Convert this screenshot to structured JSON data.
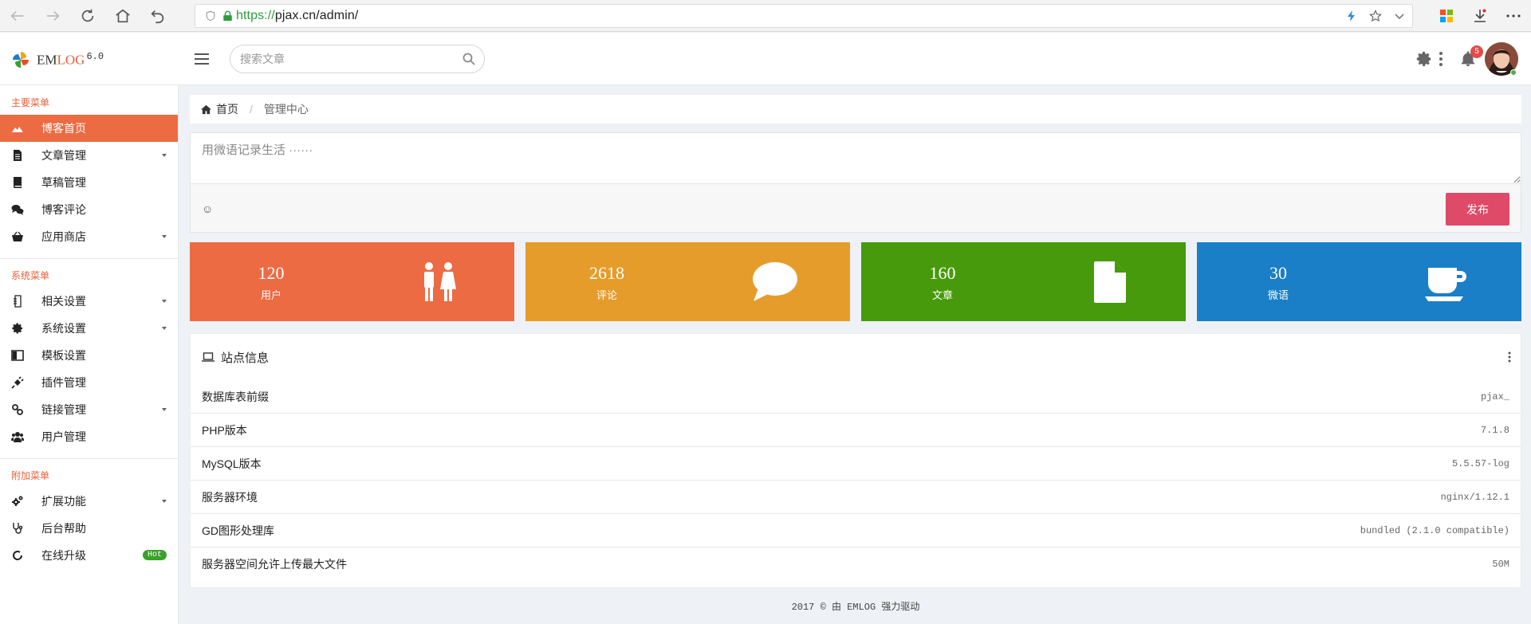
{
  "browser": {
    "url_scheme": "https://",
    "url_rest": "pjax.cn/admin/"
  },
  "header": {
    "brand_em": "EM",
    "brand_log": "LOG",
    "brand_version": "6.0",
    "search_placeholder": "搜索文章",
    "notification_count": "5"
  },
  "sidebar": {
    "section_main": "主要菜单",
    "section_system": "系统菜单",
    "section_extra": "附加菜单",
    "main_items": [
      {
        "label": "博客首页",
        "icon": "dashboard-icon",
        "active": true
      },
      {
        "label": "文章管理",
        "icon": "file-icon",
        "caret": true
      },
      {
        "label": "草稿管理",
        "icon": "book-icon"
      },
      {
        "label": "博客评论",
        "icon": "comments-icon"
      },
      {
        "label": "应用商店",
        "icon": "basket-icon",
        "caret": true
      }
    ],
    "system_items": [
      {
        "label": "相关设置",
        "icon": "settings-file-icon",
        "caret": true
      },
      {
        "label": "系统设置",
        "icon": "gear-icon",
        "caret": true
      },
      {
        "label": "模板设置",
        "icon": "template-icon"
      },
      {
        "label": "插件管理",
        "icon": "plug-icon"
      },
      {
        "label": "链接管理",
        "icon": "link-icon",
        "caret": true
      },
      {
        "label": "用户管理",
        "icon": "users-icon"
      }
    ],
    "extra_items": [
      {
        "label": "扩展功能",
        "icon": "cogs-icon",
        "caret": true
      },
      {
        "label": "后台帮助",
        "icon": "stethoscope-icon"
      },
      {
        "label": "在线升级",
        "icon": "refresh-icon",
        "badge": "Hot"
      }
    ]
  },
  "breadcrumb": {
    "home": "首页",
    "separator": "/",
    "current": "管理中心"
  },
  "composer": {
    "placeholder": "用微语记录生活 ······",
    "emoji": "☺",
    "publish_label": "发布"
  },
  "stats": [
    {
      "value": "120",
      "label": "用户",
      "color": "#ec6b43",
      "icon": "users-pair-icon"
    },
    {
      "value": "2618",
      "label": "评论",
      "color": "#e59c2a",
      "icon": "comment-icon"
    },
    {
      "value": "160",
      "label": "文章",
      "color": "#479a0b",
      "icon": "document-icon"
    },
    {
      "value": "30",
      "label": "微语",
      "color": "#1a7fc6",
      "icon": "coffee-icon"
    }
  ],
  "siteinfo": {
    "title": "站点信息",
    "rows": [
      {
        "key": "数据库表前缀",
        "value": "pjax_"
      },
      {
        "key": "PHP版本",
        "value": "7.1.8"
      },
      {
        "key": "MySQL版本",
        "value": "5.5.57-log"
      },
      {
        "key": "服务器环境",
        "value": "nginx/1.12.1"
      },
      {
        "key": "GD图形处理库",
        "value": "bundled (2.1.0 compatible)"
      },
      {
        "key": "服务器空间允许上传最大文件",
        "value": "50M"
      }
    ]
  },
  "footer": {
    "text": "2017 © 由 EMLOG 强力驱动"
  }
}
